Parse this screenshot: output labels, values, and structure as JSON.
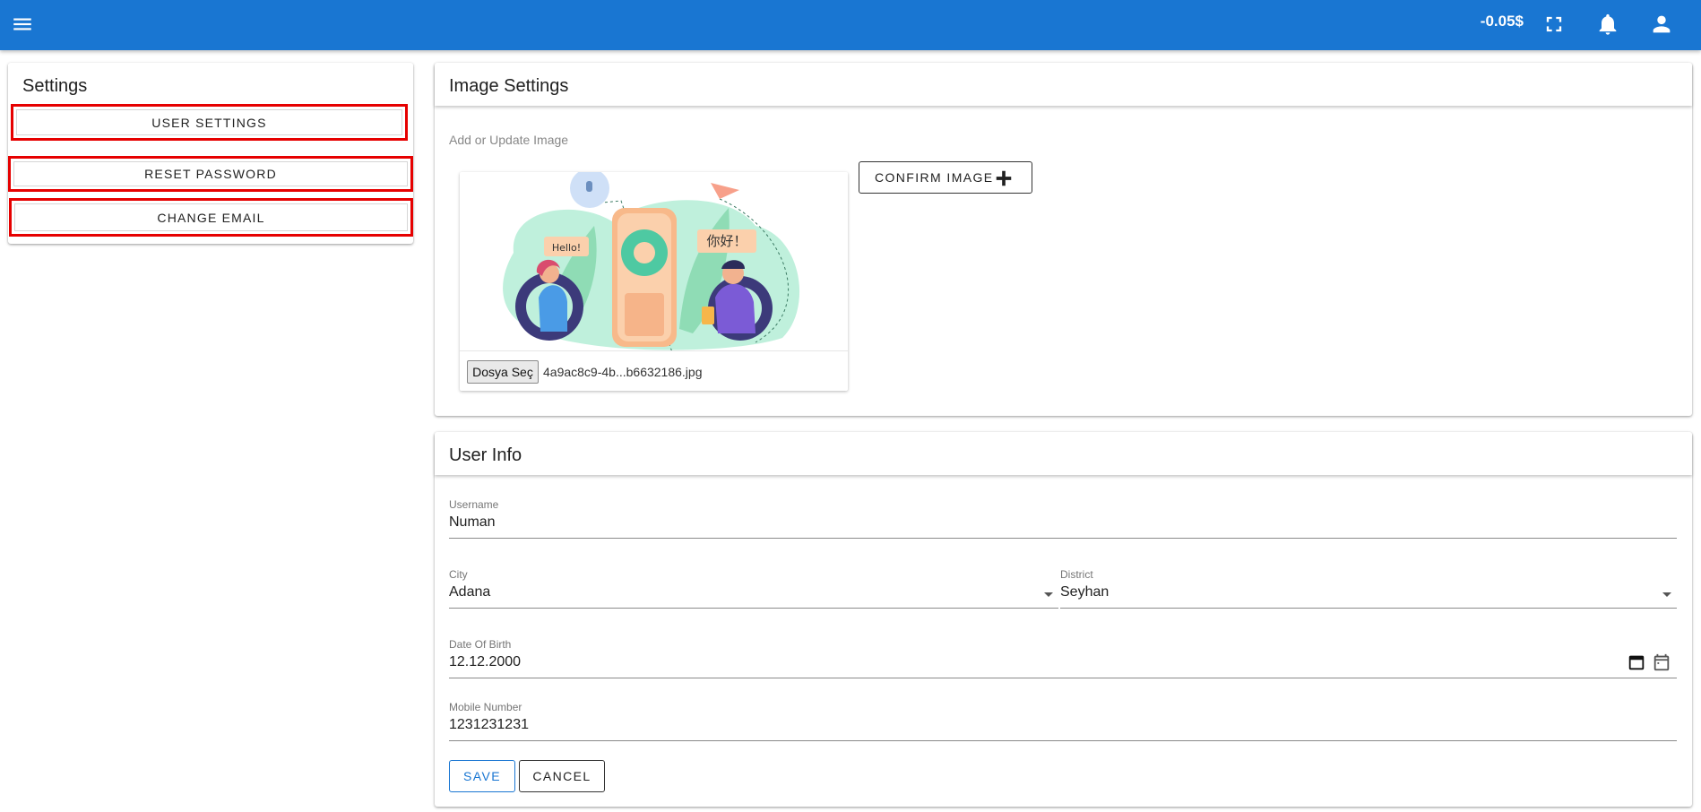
{
  "topbar": {
    "menu_icon": "menu-icon",
    "balance": "-0.05$",
    "icons": [
      "fullscreen-icon",
      "bell-icon",
      "account-icon"
    ],
    "color": "#1976d2"
  },
  "settings": {
    "title": "Settings",
    "buttons": [
      {
        "label": "USER SETTINGS"
      },
      {
        "label": "RESET PASSWORD"
      },
      {
        "label": "CHANGE EMAIL"
      }
    ],
    "highlight_color": "#e60000"
  },
  "image_settings": {
    "title": "Image Settings",
    "subtitle": "Add or Update Image",
    "art_labels": {
      "hello": "Hello!",
      "chinese": "你好！"
    },
    "file_button": "Dosya Seç",
    "file_name": "4a9ac8c9-4b...b6632186.jpg",
    "confirm_button": "CONFIRM IMAGE",
    "confirm_icon": "plus-icon"
  },
  "user_info": {
    "title": "User Info",
    "username": {
      "label": "Username",
      "value": "Numan"
    },
    "city": {
      "label": "City",
      "value": "Adana"
    },
    "district": {
      "label": "District",
      "value": "Seyhan"
    },
    "dob": {
      "label": "Date Of Birth",
      "value": "12.12.2000"
    },
    "mobile": {
      "label": "Mobile Number",
      "value": "1231231231"
    },
    "save_button": "SAVE",
    "cancel_button": "CANCEL"
  }
}
